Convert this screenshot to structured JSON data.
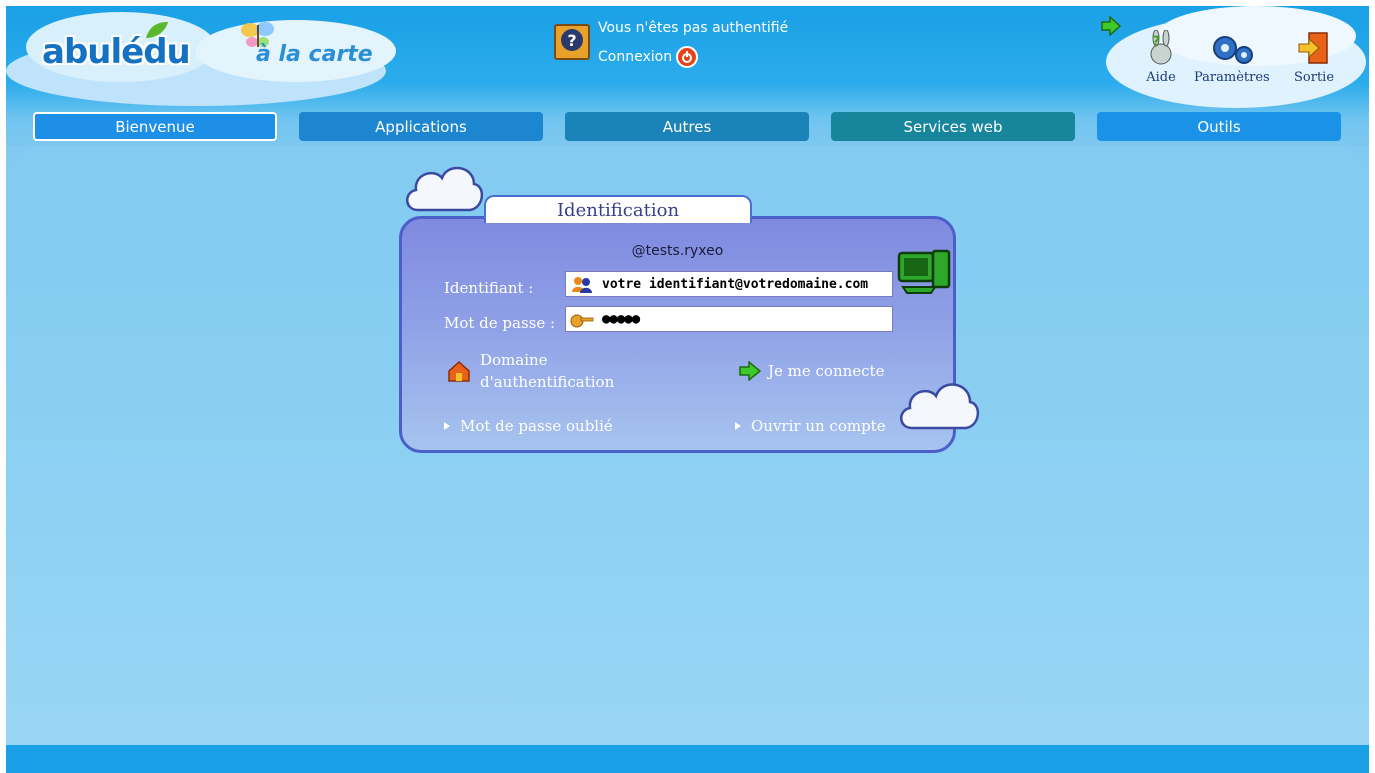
{
  "brand": {
    "logo_text": "abulédu",
    "sublogo_text": "à la carte"
  },
  "auth": {
    "status_text": "Vous n'êtes pas authentifié",
    "login_text": "Connexion"
  },
  "tools": {
    "help_label": "Aide",
    "settings_label": "Paramètres",
    "exit_label": "Sortie"
  },
  "nav": {
    "tabs": [
      {
        "label": "Bienvenue"
      },
      {
        "label": "Applications"
      },
      {
        "label": "Autres"
      },
      {
        "label": "Services web"
      },
      {
        "label": "Outils"
      }
    ]
  },
  "ident": {
    "tab_title": "Identification",
    "domain": "@tests.ryxeo",
    "username_label": "Identifiant :",
    "username_value": "votre identifiant@votredomaine.com",
    "password_label": "Mot de passe :",
    "password_value": "●●●●●",
    "domain_link_line1": "Domaine",
    "domain_link_line2": "d'authentification",
    "connect_label": "Je me connecte",
    "forgot_label": "Mot de passe oublié",
    "open_account_label": "Ouvrir un compte"
  },
  "colors": {
    "header_blue": "#1aa0e6",
    "nav_active": "#1d8fe6",
    "panel": "#8fa0e6",
    "panel_border": "#4a5fc8"
  }
}
